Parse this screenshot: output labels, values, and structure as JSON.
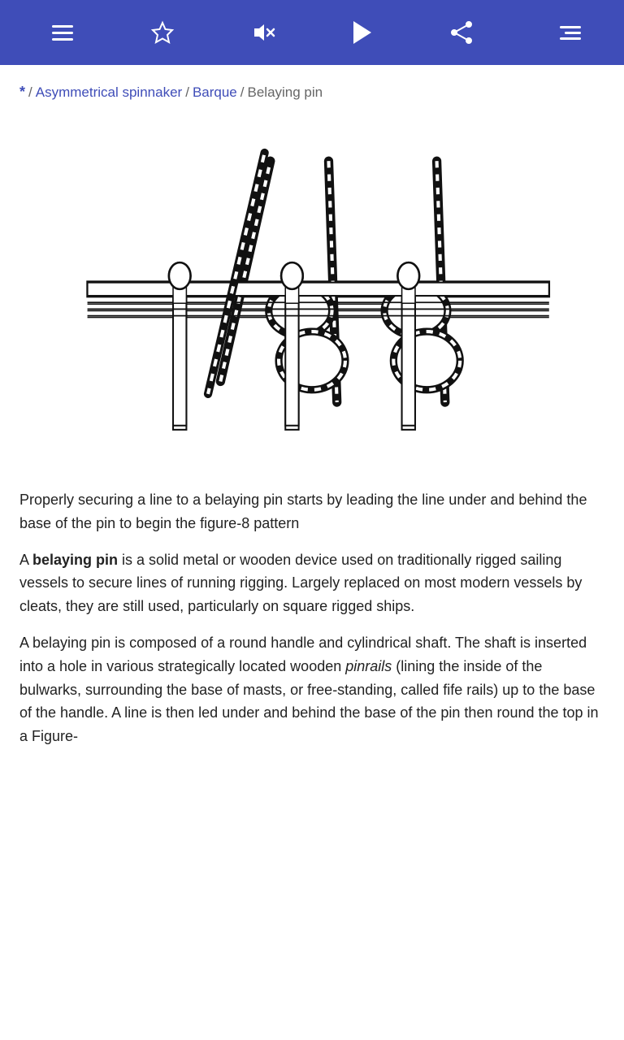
{
  "navbar": {
    "hamburger_label": "hamburger menu",
    "star_label": "bookmark",
    "mute_label": "mute",
    "play_label": "play",
    "share_label": "share",
    "menu_label": "more options"
  },
  "breadcrumb": {
    "star": "*",
    "separator1": "/",
    "link1": "Asymmetrical spinnaker",
    "separator2": "/",
    "link2": "Barque",
    "separator3": "/",
    "current": "Belaying pin"
  },
  "body": {
    "paragraph1": "Properly securing a line to a belaying pin starts by leading the line under and behind the base of the pin to begin the figure-8 pattern",
    "sentence_prefix": "A ",
    "bold_word": "belaying pin",
    "sentence_suffix": " is a solid metal or wooden device used on traditionally rigged sailing vessels to secure lines of running rigging. Largely replaced on most modern vessels by cleats, they are still used, particularly on square rigged ships.",
    "paragraph2_prefix": "A belaying pin is composed of a round handle and cylindrical shaft. The shaft is inserted into a hole in various strategically located wooden ",
    "italic_word": "pinrails",
    "paragraph2_suffix": " (lining the inside of the bulwarks, surrounding the base of masts, or free-standing, called fife rails) up to the base of the handle. A line is then led under and behind the base of the pin then round the top in a Figure-"
  },
  "colors": {
    "navbar_bg": "#3f4db8",
    "link_color": "#3f4db8",
    "text_color": "#222222",
    "muted_color": "#666666"
  }
}
